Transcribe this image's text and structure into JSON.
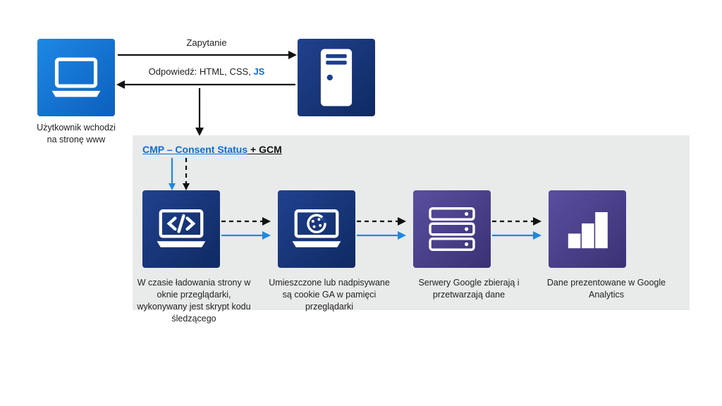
{
  "top": {
    "client_caption": "Użytkownik wchodzi na stronę www",
    "request_label": "Zapytanie",
    "response_prefix": "Odpowiedź: HTML, CSS, ",
    "response_js": "JS"
  },
  "lower_title": {
    "link": "CMP – Consent Status",
    "plain": " + GCM"
  },
  "stages": [
    "W czasie ładowania strony w oknie przeglądarki, wykonywany jest skrypt kodu śledzącego",
    "Umieszczone lub nadpisywane są cookie GA w pamięci przeglądarki",
    "Serwery Google zbierają i przetwarzają dane",
    "Dane prezentowane w Google Analytics"
  ]
}
